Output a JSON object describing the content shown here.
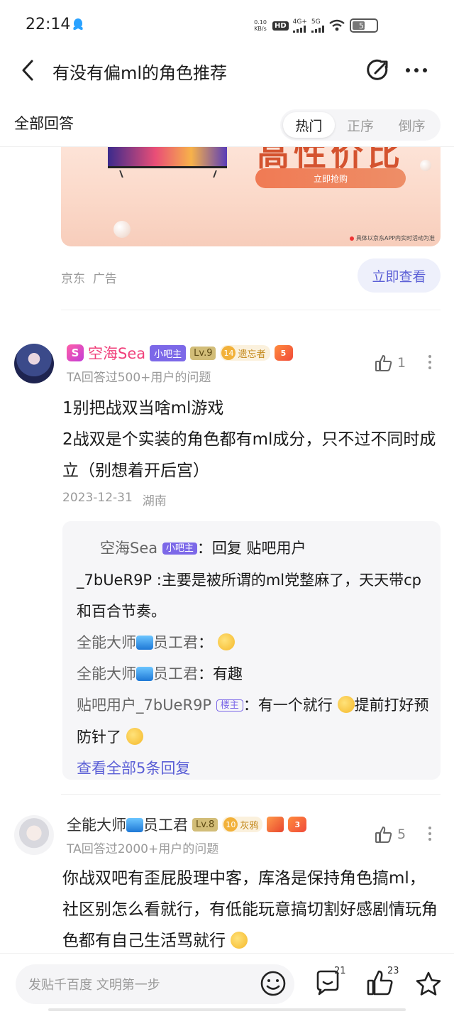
{
  "status_bar": {
    "time": "22:14",
    "speed_value": "0.10",
    "speed_unit": "KB/s",
    "hd": "HD",
    "net1": "4G+",
    "net2": "5G",
    "battery": "53"
  },
  "header": {
    "title": "有没有偏ml的角色推荐",
    "icons": [
      "back-icon",
      "share-icon",
      "more-icon"
    ]
  },
  "answers_bar": {
    "title": "全部回答",
    "sort_tabs": [
      {
        "label": "热门",
        "active": true
      },
      {
        "label": "正序",
        "active": false
      },
      {
        "label": "倒序",
        "active": false
      }
    ]
  },
  "ad": {
    "headline": "高性价比",
    "cta": "立即抢购",
    "note": "具体以京东APP内实时活动为准",
    "source": "京东",
    "label": "广告",
    "button": "立即查看"
  },
  "answer1": {
    "username": "空海Sea",
    "owner_tag": "小吧主",
    "level": "Lv.9",
    "honor_num": "14",
    "honor_label": "遗忘者",
    "game_badge_num": "5",
    "subtitle": "TA回答过500+用户的问题",
    "likes": "1",
    "lines": [
      "1别把战双当啥ml游戏",
      "2战双是个实装的角色都有ml成分，只不过不同时成立（别想着开后宫）"
    ],
    "date": "2023-12-31",
    "location": "湖南",
    "replies": {
      "r1_name": "空海Sea",
      "r1_tag": "小吧主",
      "r1_sep": "：",
      "r1_text_a": "回复 贴吧用户",
      "r1_text_b": "_7bUeR9P :主要是被所谓的ml党整麻了，天天带cp和百合节奏。",
      "r2_name_a": "全能大师",
      "r2_name_b": "员工君",
      "r2_sep": "：",
      "r3_name_a": "全能大师",
      "r3_name_b": "员工君",
      "r3_sep": "：",
      "r3_text": "有趣",
      "r4_name": "贴吧用户_7bUeR9P",
      "r4_tag": "楼主",
      "r4_sep": "：",
      "r4_text_a": "有一个就行",
      "r4_text_b": "提前打好预防针了",
      "view_all": "查看全部5条回复"
    }
  },
  "answer2": {
    "username_a": "全能大师",
    "username_b": "员工君",
    "level": "Lv.8",
    "honor_num": "10",
    "honor_label": "灰鸦",
    "game_badge_num": "3",
    "subtitle": "TA回答过2000+用户的问题",
    "likes": "5",
    "text": "你战双吧有歪屁股理中客，库洛是保持角色搞ml，社区别怎么看就行，有低能玩意搞切割好感剧情玩角色都有自己生活骂就行"
  },
  "bottom_bar": {
    "input_placeholder": "发贴千百度 文明第一步",
    "comment_count": "21",
    "like_count": "23"
  },
  "colors": {
    "accent": "#5b5fd6",
    "owner_tag": "#7c68e8",
    "username_pink": "#f0407b"
  }
}
